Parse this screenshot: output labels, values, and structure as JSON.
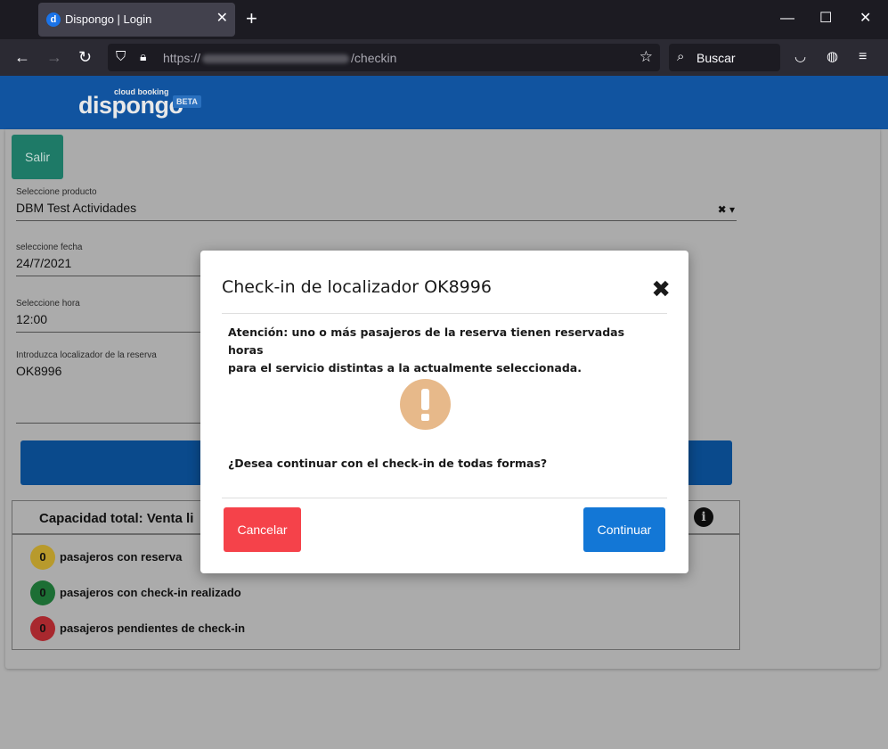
{
  "browser": {
    "tab_title": "Dispongo | Login",
    "tab_favicon_letter": "d",
    "url_prefix": "https://",
    "url_path": "/checkin",
    "search_placeholder": "Buscar"
  },
  "header": {
    "logo_sub": "cloud booking",
    "logo_main": "dispongo",
    "beta_badge": "BETA"
  },
  "form": {
    "exit_label": "Salir",
    "product": {
      "label": "Seleccione producto",
      "value": "DBM Test Actividades"
    },
    "date": {
      "label": "seleccione fecha",
      "value": "24/7/2021"
    },
    "time": {
      "label": "Seleccione hora",
      "value": "12:00"
    },
    "locator": {
      "label": "Introduzca localizador de la reserva",
      "value": "OK8996"
    }
  },
  "capacity": {
    "title": "Capacidad total:  Venta li",
    "rows": [
      {
        "count": "0",
        "text": "pasajeros con reserva",
        "color": "#b89a2c"
      },
      {
        "count": "0",
        "text": "pasajeros con check-in realizado",
        "color": "#1c6e34"
      },
      {
        "count": "0",
        "text": "pasajeros pendientes de check-in",
        "color": "#a8282e"
      }
    ]
  },
  "modal": {
    "title": "Check-in de localizador OK8996",
    "message_line1": "Atención: uno o más pasajeros de la reserva tienen reservadas horas",
    "message_line2": "para el servicio distintas a la actualmente seleccionada.",
    "question": "¿Desea continuar con el check-in de todas formas?",
    "cancel_label": "Cancelar",
    "continue_label": "Continuar",
    "icon": "warning-icon"
  },
  "colors": {
    "header_blue": "#1154a0",
    "cancel_red": "#f5424a",
    "continue_blue": "#1377d6",
    "warning_tan": "#e7b98a"
  }
}
